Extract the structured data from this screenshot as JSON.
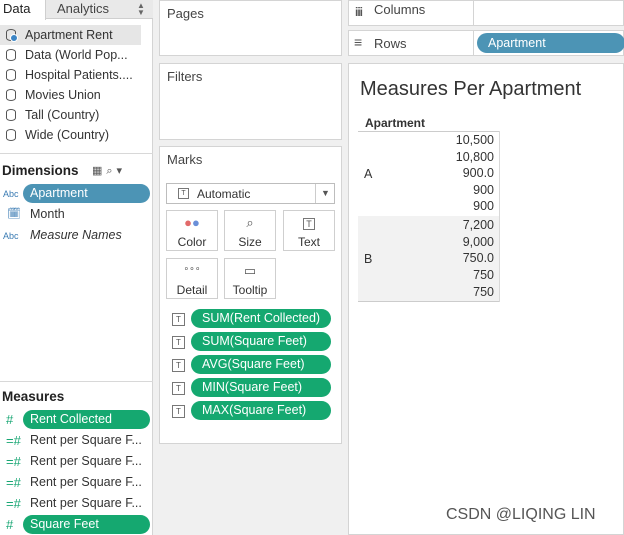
{
  "left_pane": {
    "tabs": {
      "data": "Data",
      "analytics": "Analytics"
    },
    "data_sources": [
      {
        "label": "Apartment Rent",
        "selected": true
      },
      {
        "label": "Data (World Pop...",
        "selected": false
      },
      {
        "label": "Hospital Patients....",
        "selected": false
      },
      {
        "label": "Movies Union",
        "selected": false
      },
      {
        "label": "Tall (Country)",
        "selected": false
      },
      {
        "label": "Wide (Country)",
        "selected": false
      }
    ],
    "dimensions": {
      "title": "Dimensions",
      "fields": [
        {
          "type": "Abc",
          "label": "Apartment",
          "on_shelf": true
        },
        {
          "type": "date",
          "label": "Month",
          "on_shelf": false
        },
        {
          "type": "Abc",
          "label": "Measure Names",
          "on_shelf": false
        }
      ]
    },
    "measures": {
      "title": "Measures",
      "fields": [
        {
          "label": "Rent Collected",
          "on_shelf": true
        },
        {
          "label": "Rent per Square F...",
          "on_shelf": false
        },
        {
          "label": "Rent per Square F...",
          "on_shelf": false
        },
        {
          "label": "Rent per Square F...",
          "on_shelf": false
        },
        {
          "label": "Rent per Square F...",
          "on_shelf": false
        },
        {
          "label": "Square Feet",
          "on_shelf": true
        }
      ]
    }
  },
  "cards": {
    "pages": "Pages",
    "filters": "Filters",
    "marks": {
      "title": "Marks",
      "mark_type": "Automatic",
      "buttons": [
        "Color",
        "Size",
        "Text",
        "Detail",
        "Tooltip"
      ],
      "pills": [
        "SUM(Rent Collected)",
        "SUM(Square Feet)",
        "AVG(Square Feet)",
        "MIN(Square Feet)",
        "MAX(Square Feet)"
      ]
    }
  },
  "shelves": {
    "columns_label": "Columns",
    "rows_label": "Rows",
    "rows_pill": "Apartment"
  },
  "view": {
    "title": "Measures Per Apartment",
    "header": "Apartment",
    "groups": [
      {
        "label": "A",
        "values": [
          "10,500",
          "10,800",
          "900.0",
          "900",
          "900"
        ]
      },
      {
        "label": "B",
        "values": [
          "7,200",
          "9,000",
          "750.0",
          "750",
          "750"
        ]
      }
    ]
  },
  "watermark": "CSDN @LIQING LIN",
  "colors": {
    "dimension_pill": "#4c94b5",
    "measure_pill": "#15a870",
    "watermark": "#555555"
  }
}
